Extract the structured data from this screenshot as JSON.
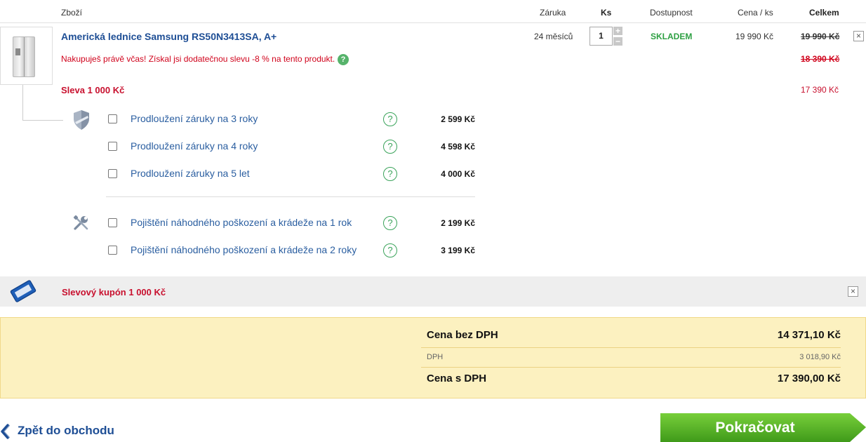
{
  "header": {
    "col_item": "Zboží",
    "col_warranty": "Záruka",
    "col_qty": "Ks",
    "col_availability": "Dostupnost",
    "col_unit_price": "Cena / ks",
    "col_total": "Celkem"
  },
  "product": {
    "name": "Americká lednice Samsung RS50N3413SA, A+",
    "promo_text": "Nakupuješ právě včas! Získal jsi dodatečnou slevu -8 % na tento produkt.",
    "warranty": "24 měsíců",
    "quantity": "1",
    "qty_plus": "+",
    "qty_minus": "−",
    "availability": "SKLADEM",
    "unit_price": "19 990 Kč",
    "total_original": "19 990 Kč",
    "total_discounted_strike": "18 390 Kč",
    "discount_label": "Sleva 1 000 Kč",
    "total_final": "17 390 Kč",
    "remove_glyph": "×"
  },
  "services": {
    "help_glyph": "?",
    "warranty_group": [
      {
        "label": "Prodloužení záruky na 3 roky",
        "price": "2 599 Kč"
      },
      {
        "label": "Prodloužení záruky na 4 roky",
        "price": "4 598 Kč"
      },
      {
        "label": "Prodloužení záruky na 5 let",
        "price": "4 000 Kč"
      }
    ],
    "insurance_group": [
      {
        "label": "Pojištění náhodného poškození a krádeže na 1 rok",
        "price": "2 199 Kč"
      },
      {
        "label": "Pojištění náhodného poškození a krádeže na 2 roky",
        "price": "3 199 Kč"
      }
    ]
  },
  "coupon": {
    "label": "Slevový kupón 1 000 Kč",
    "remove_glyph": "×"
  },
  "summary": {
    "without_vat_label": "Cena bez DPH",
    "without_vat_value": "14 371,10 Kč",
    "vat_label": "DPH",
    "vat_value": "3 018,90 Kč",
    "with_vat_label": "Cena s DPH",
    "with_vat_value": "17 390,00 Kč"
  },
  "actions": {
    "back_label": "Zpět do obchodu",
    "continue_label": "Pokračovat"
  },
  "colors": {
    "link_blue": "#1e4e95",
    "discount_red": "#c8102e",
    "stock_green": "#2ea043",
    "continue_green": "#5cb82b",
    "summary_bg": "#fcf1c0"
  },
  "icons": {
    "warranty_group": "shield-icon",
    "insurance_group": "wrench-screwdriver-icon",
    "coupon": "coupon-ticket-icon",
    "back": "chevron-left-icon"
  }
}
